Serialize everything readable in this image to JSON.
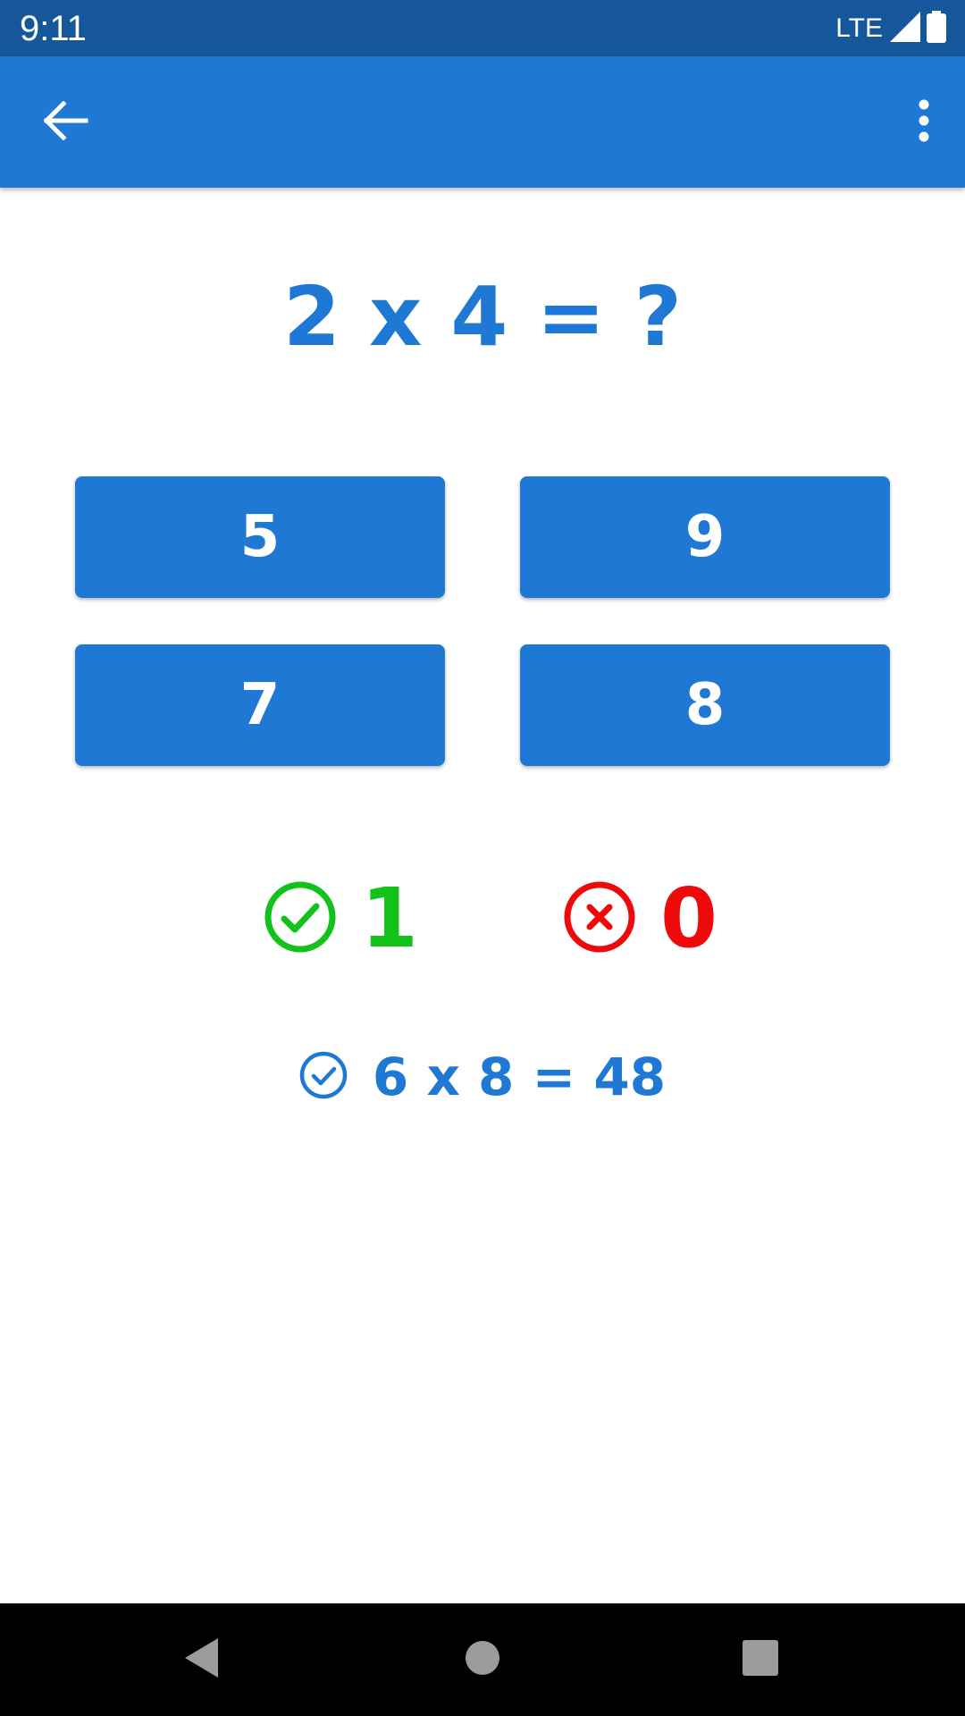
{
  "status_bar": {
    "time": "9:11",
    "network": "LTE",
    "icons": [
      "signal-icon",
      "battery-icon"
    ]
  },
  "app_bar": {
    "icons": [
      "back-arrow-icon",
      "more-vert-icon"
    ]
  },
  "quiz": {
    "question": "2 x 4 = ?",
    "answers": [
      "5",
      "9",
      "7",
      "8"
    ]
  },
  "score": {
    "correct": "1",
    "wrong": "0",
    "correct_icon": "check-circle-icon",
    "wrong_icon": "x-circle-icon"
  },
  "last_answer": {
    "icon": "check-circle-outline-icon",
    "text": "6 x 8 = 48"
  },
  "nav_bar": {
    "icons": [
      "nav-back-icon",
      "nav-home-icon",
      "nav-recents-icon"
    ]
  },
  "colors": {
    "status_bar": "#15579a",
    "primary": "#1e78d4",
    "correct": "#12c11a",
    "wrong": "#ee0a0a"
  }
}
